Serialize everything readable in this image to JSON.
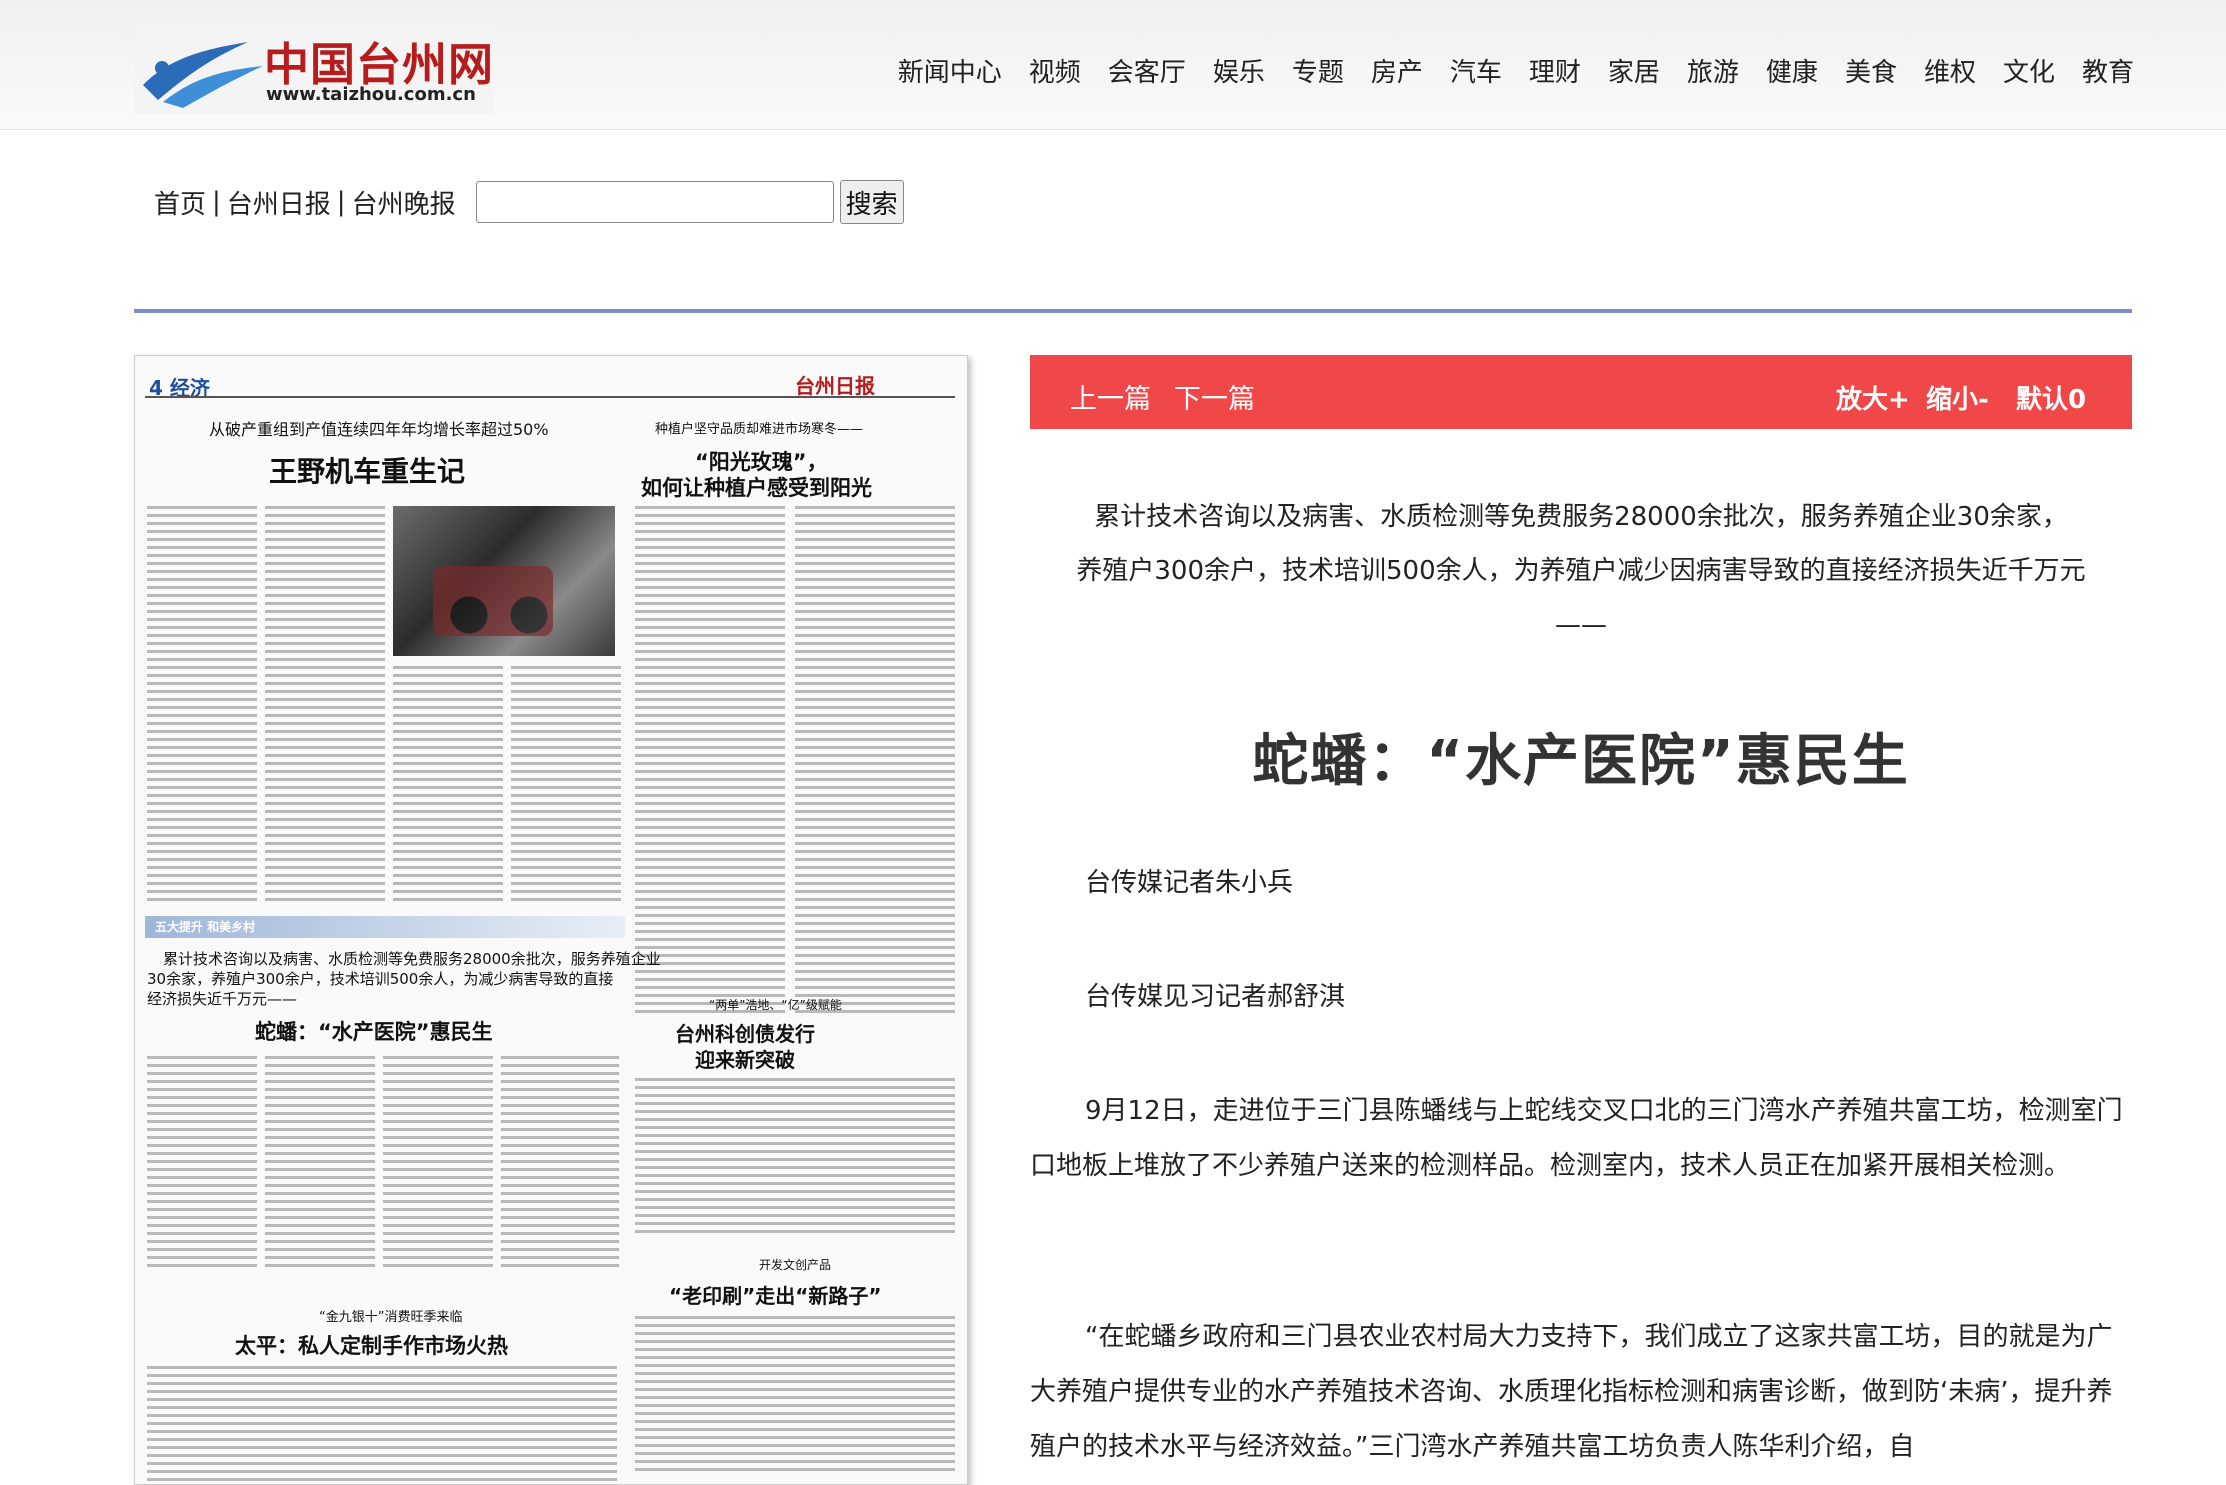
{
  "site": {
    "logo_cn": "中国台州网",
    "logo_url": "www.taizhou.com.cn"
  },
  "nav": [
    "新闻中心",
    "视频",
    "会客厅",
    "娱乐",
    "专题",
    "房产",
    "汽车",
    "理财",
    "家居",
    "旅游",
    "健康",
    "美食",
    "维权",
    "文化",
    "教育"
  ],
  "subnav": {
    "home": "首页",
    "daily": "台州日报",
    "evening": "台州晚报",
    "separator": "|",
    "search_value": "",
    "search_button": "搜索"
  },
  "newspaper": {
    "page_tag": "4 经济",
    "masthead": "台州日报",
    "headline1_sub": "从破产重组到产值连续四年年均增长率超过50%",
    "headline1": "王野机车重生记",
    "headline2_sub": "种植户坚守品质却难进市场寒冬——",
    "headline2": "“阳光玫瑰”，",
    "headline2b": "如何让种植户感受到阳光",
    "section_label": "五大提升 和美乡村",
    "lead_small": "累计技术咨询以及病害、水质检测等免费服务28000余批次，服务养殖企业",
    "lead_small2": "30余家，养殖户300余户，技术培训500余人，为减少病害导致的直接",
    "lead_small3": "经济损失近千万元——",
    "headline3": "蛇蟠：“水产医院”惠民生",
    "headline4_sub": "“两单”浩地、“亿”级赋能",
    "headline4": "台州科创债发行",
    "headline4b": "迎来新突破",
    "headline5_sub": "开发文创产品",
    "headline5": "“老印刷”走出“新路子”",
    "headline6_sub": "“金九银十”消费旺季来临",
    "headline6": "太平：私人定制手作市场火热"
  },
  "toolbar": {
    "prev": "上一篇",
    "next": "下一篇",
    "zoom_in": "放大+",
    "zoom_out": "缩小-",
    "default": "默认0"
  },
  "article": {
    "lead_line1": "累计技术咨询以及病害、水质检测等免费服务28000余批次，服务养殖企业30余家，",
    "lead_line2": "养殖户300余户，技术培训500余人，为养殖户减少因病害导致的直接经济损失近千万元",
    "lead_line3": "——",
    "title": "蛇蟠：“水产医院”惠民生",
    "byline1": "台传媒记者朱小兵",
    "byline2": "台传媒见习记者郝舒淇",
    "para1": "9月12日，走进位于三门县陈蟠线与上蛇线交叉口北的三门湾水产养殖共富工坊，检测室门口地板上堆放了不少养殖户送来的检测样品。检测室内，技术人员正在加紧开展相关检测。",
    "para2": "“在蛇蟠乡政府和三门县农业农村局大力支持下，我们成立了这家共富工坊，目的就是为广大养殖户提供专业的水产养殖技术咨询、水质理化指标检测和病害诊断，做到防‘未病’，提升养殖户的技术水平与经济效益。”三门湾水产养殖共富工坊负责人陈华利介绍，自"
  }
}
